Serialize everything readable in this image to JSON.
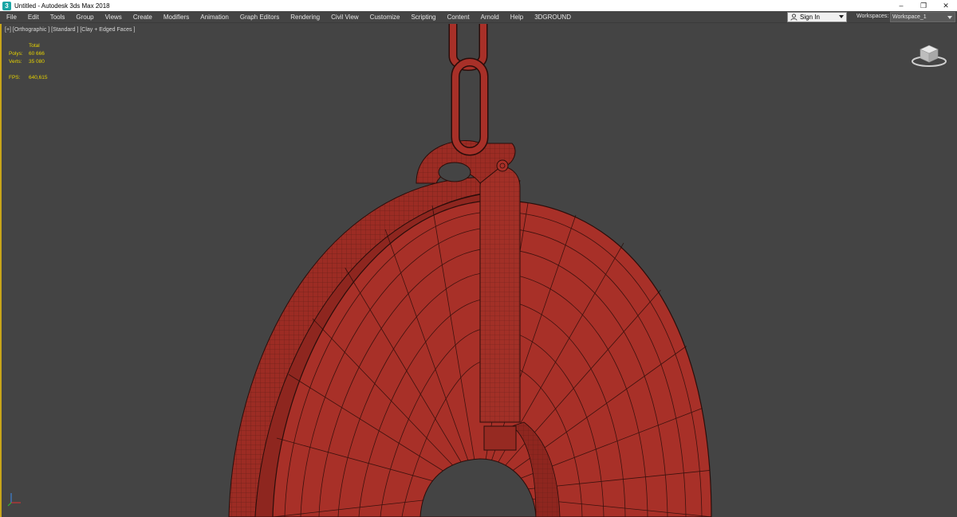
{
  "window": {
    "title": "Untitled - Autodesk 3ds Max 2018",
    "icon": "3ds-max-app-icon",
    "controls": {
      "minimize": "–",
      "restore": "❐",
      "close": "✕"
    }
  },
  "menu": {
    "items": [
      "File",
      "Edit",
      "Tools",
      "Group",
      "Views",
      "Create",
      "Modifiers",
      "Animation",
      "Graph Editors",
      "Rendering",
      "Civil View",
      "Customize",
      "Scripting",
      "Content",
      "Arnold",
      "Help",
      "3DGROUND"
    ],
    "sign_in": "Sign In",
    "workspaces_label": "Workspaces:",
    "workspace_value": "Workspace_1"
  },
  "viewport": {
    "label": "[+] [Orthographic ] [Standard ] [Clay + Edged Faces ]",
    "stats": {
      "header": "Total",
      "polys_label": "Polys:",
      "polys_value": "60 666",
      "verts_label": "Verts:",
      "verts_value": "35 080",
      "fps_label": "FPS:",
      "fps_value": "640,615"
    },
    "active_border_color": "#c8a51a",
    "background_color": "#444444",
    "clay_color": "#a83028"
  }
}
